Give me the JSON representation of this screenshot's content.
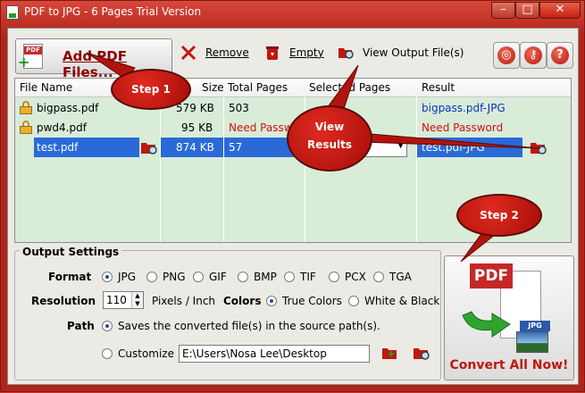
{
  "window": {
    "title": "PDF to JPG - 6 Pages Trial Version"
  },
  "toolbar": {
    "add_label": "Add PDF Files...",
    "add_icon_text": "PDF",
    "remove_label": "Remove",
    "empty_label": "Empty",
    "view_label": "View Output File(s)"
  },
  "table": {
    "columns": [
      "File Name",
      "Size",
      "Total Pages",
      "Selected Pages",
      "Result"
    ],
    "rows": [
      {
        "name": "bigpass.pdf",
        "size": "579 KB",
        "pages": "503",
        "selected": "",
        "result": "bigpass.pdf-JPG"
      },
      {
        "name": "pwd4.pdf",
        "size": "95 KB",
        "pages": "Need Password",
        "selected": "",
        "result": "Need Password"
      },
      {
        "name": "test.pdf",
        "size": "874 KB",
        "pages": "57",
        "selected": "",
        "result": "test.pdf-JPG"
      }
    ]
  },
  "output": {
    "legend": "Output Settings",
    "format_label": "Format",
    "formats": [
      "JPG",
      "PNG",
      "GIF",
      "BMP",
      "TIF",
      "PCX",
      "TGA"
    ],
    "selected_format": "JPG",
    "resolution_label": "Resolution",
    "resolution_value": "110",
    "resolution_unit": "Pixels / Inch",
    "colors_label": "Colors",
    "color_options": [
      "True Colors",
      "White & Black"
    ],
    "selected_color": "True Colors",
    "path_label": "Path",
    "path_option1": "Saves the converted file(s) in the source path(s).",
    "path_option2": "Customize",
    "path_value": "E:\\Users\\Nosa Lee\\Desktop"
  },
  "convert": {
    "label": "Convert All Now!",
    "pdf_text": "PDF",
    "jpg_text": "JPG"
  },
  "callouts": {
    "step1": "Step 1",
    "view_results_line1": "View",
    "view_results_line2": "Results",
    "step2": "Step 2"
  },
  "colors": {
    "frame": "#c0392b",
    "selection": "#2a6ad8",
    "table_bg": "#d8ecd8",
    "error": "#d01010",
    "link": "#1030c0"
  }
}
